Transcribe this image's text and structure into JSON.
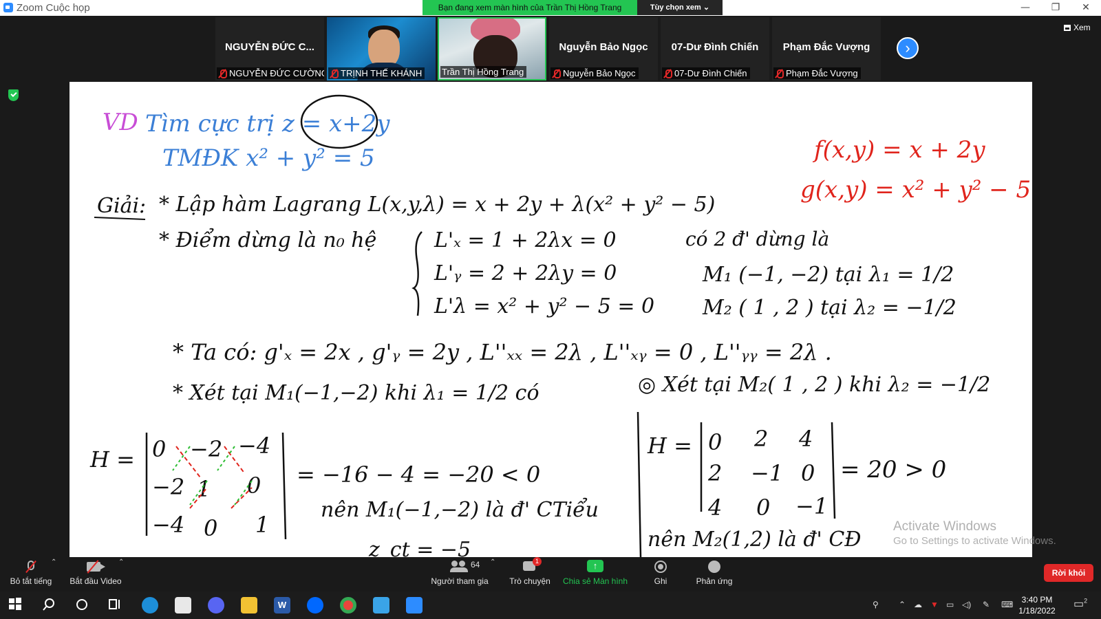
{
  "window": {
    "title": "Zoom Cuộc họp",
    "share_banner": "Bạn đang xem màn hình của Trần Thị Hồng Trang",
    "view_options": "Tùy chọn xem ⌄",
    "minimize": "—",
    "restore": "❐",
    "close": "✕"
  },
  "gallery": {
    "view_button": "Xem",
    "tiles": [
      {
        "big_name": "NGUYỄN ĐỨC C...",
        "nametag": "NGUYỄN ĐỨC CƯỜNG",
        "muted": true
      },
      {
        "big_name": "",
        "nametag": "TRỊNH THẾ KHÁNH",
        "muted": true
      },
      {
        "big_name": "",
        "nametag": "Trần Thị Hồng Trang",
        "muted": false
      },
      {
        "big_name": "Nguyễn Bảo Ngọc",
        "nametag": "Nguyễn Bảo Ngọc",
        "muted": true
      },
      {
        "big_name": "07-Dư Đình Chiến",
        "nametag": "07-Dư Đình Chiến",
        "muted": true
      },
      {
        "big_name": "Phạm Đắc Vượng",
        "nametag": "Phạm Đắc Vượng",
        "muted": true
      }
    ]
  },
  "whiteboard": {
    "lines": {
      "vd": "VD",
      "problem_1": "Tìm cực trị z = x+2y",
      "problem_2": "TMĐK  x² + y² = 5",
      "red_f": "f(x,y) = x + 2y",
      "red_g": "g(x,y) = x² + y² − 5",
      "giai": "Giải:",
      "step_1": "* Lập hàm Lagrang   L(x,y,λ) = x + 2y + λ(x² + y² − 5)",
      "step_2": "* Điểm dừng là n₀ hệ",
      "sys_1": "L'ₓ = 1 + 2λx = 0",
      "sys_2": "L'ᵧ = 2 + 2λy = 0",
      "sys_3": "L'λ = x² + y² − 5 = 0",
      "sol_head": "có 2 đ' dừng là",
      "sol_1": "M₁ (−1, −2) tại λ₁ = 1/2",
      "sol_2": "M₂ ( 1 , 2 ) tại λ₂ = −1/2",
      "ta_co": "* Ta có:   g'ₓ = 2x , g'ᵧ = 2y , L''ₓₓ = 2λ , L''ₓᵧ = 0 , L''ᵧᵧ = 2λ .",
      "xet_1": "* Xét tại M₁(−1,−2) khi λ₁ = 1/2 có",
      "xet_2": "◎ Xét tại M₂( 1 , 2 )  khi λ₂ = −1/2",
      "h_label_1": "H =",
      "h_label_2": "H =",
      "m1_row1": [
        "0",
        "−2",
        "−4"
      ],
      "m1_row2": [
        "−2",
        "1",
        "0"
      ],
      "m1_row3": [
        "−4",
        "0",
        "1"
      ],
      "m2_row1": [
        "0",
        "2",
        "4"
      ],
      "m2_row2": [
        "2",
        "−1",
        "0"
      ],
      "m2_row3": [
        "4",
        "0",
        "−1"
      ],
      "det_1": "= −16 − 4 = −20 < 0",
      "concl_1": "nên M₁(−1,−2) là đ' CTiểu",
      "zmin": "z_ct = −5",
      "det_2": "= 20 > 0",
      "concl_2": "nên M₂(1,2) là đ' CĐ"
    },
    "watermark_1": "Activate Windows",
    "watermark_2": "Go to Settings to activate Windows."
  },
  "toolbar": {
    "mute_all": "Bỏ tắt tiếng",
    "start_video": "Bắt đầu Video",
    "participants": "Người tham gia",
    "participant_count": "64",
    "chat": "Trò chuyện",
    "chat_badge": "1",
    "share_screen": "Chia sẻ Màn hình",
    "record": "Ghi",
    "reactions": "Phản ứng",
    "leave": "Rời khỏi"
  },
  "taskbar": {
    "time": "3:40 PM",
    "date": "1/18/2022",
    "notif_count": "2"
  },
  "colors": {
    "zoom_blue": "#2d8cff",
    "share_green": "#23c552",
    "leave_red": "#e02828"
  }
}
